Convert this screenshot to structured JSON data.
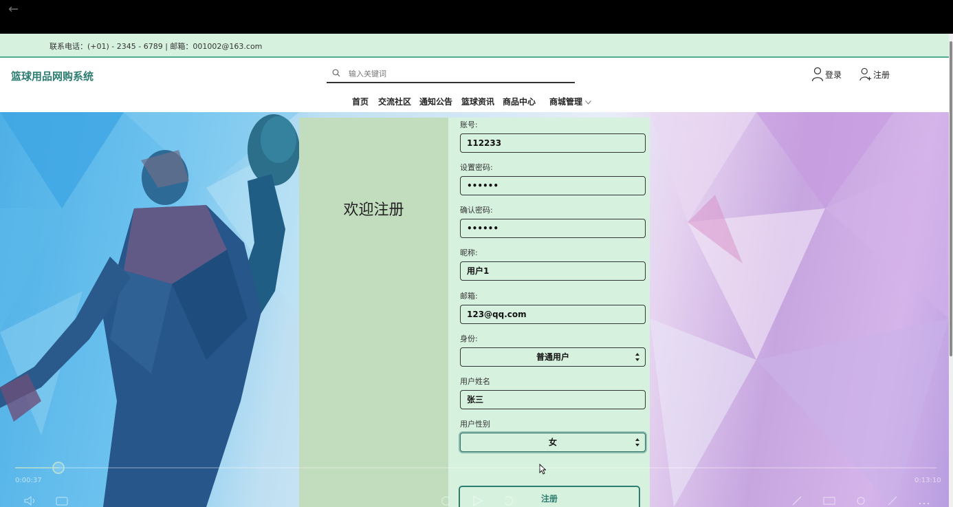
{
  "contact": "联系电话：(+01) - 2345 - 6789 | 邮箱：001002@163.com",
  "header": {
    "site_title": "篮球用品网购系统",
    "search_placeholder": "输入关键词",
    "login_label": "登录",
    "register_label": "注册"
  },
  "nav": {
    "items": [
      "首页",
      "交流社区",
      "通知公告",
      "篮球资讯",
      "商品中心",
      "商城管理"
    ]
  },
  "form": {
    "welcome": "欢迎注册",
    "fields": [
      {
        "label": "账号:",
        "value": "112233"
      },
      {
        "label": "设置密码:",
        "value": "••••••"
      },
      {
        "label": "确认密码:",
        "value": "••••••"
      },
      {
        "label": "昵称:",
        "value": "用户1"
      },
      {
        "label": "邮箱:",
        "value": "123@qq.com"
      },
      {
        "label": "身份:",
        "value": "普通用户"
      },
      {
        "label": "用户姓名",
        "value": "张三"
      },
      {
        "label": "用户性别",
        "value": "女"
      }
    ],
    "submit_label": "注册"
  },
  "player": {
    "time_current": "0:00:37",
    "time_total": "0:13:10",
    "progress_fraction": 0.047
  },
  "colors": {
    "accent": "#2c7d70",
    "panel_left": "#c2dcbe",
    "panel_right": "#d7f1df"
  }
}
